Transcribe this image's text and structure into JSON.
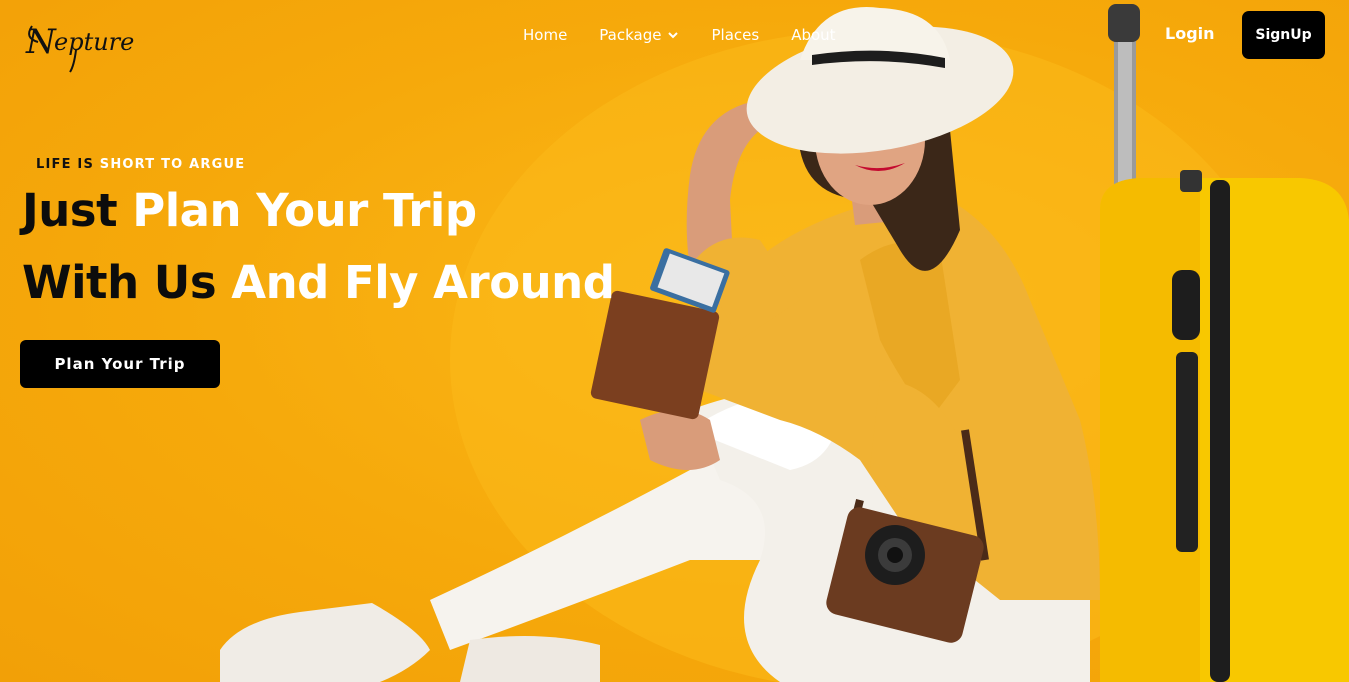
{
  "brand": {
    "name": "Nepture"
  },
  "nav": {
    "items": [
      {
        "label": "Home"
      },
      {
        "label": "Package"
      },
      {
        "label": "Places"
      },
      {
        "label": "About"
      }
    ],
    "login_label": "Login",
    "signup_label": "SignUp"
  },
  "hero": {
    "tagline_part1": "LIFE IS",
    "tagline_part2": "SHORT TO ARGUE",
    "line1_part1": "Just",
    "line1_part2": "Plan Your Trip",
    "line2_part1": "With Us",
    "line2_part2": "And Fly Around",
    "cta_label": "Plan Your Trip"
  },
  "colors": {
    "background": "#f7ac0c",
    "accent_dark": "#000000",
    "text_light": "#ffffff",
    "suitcase": "#f7c300"
  },
  "icons": {
    "package_dropdown": "chevron-down-icon"
  }
}
